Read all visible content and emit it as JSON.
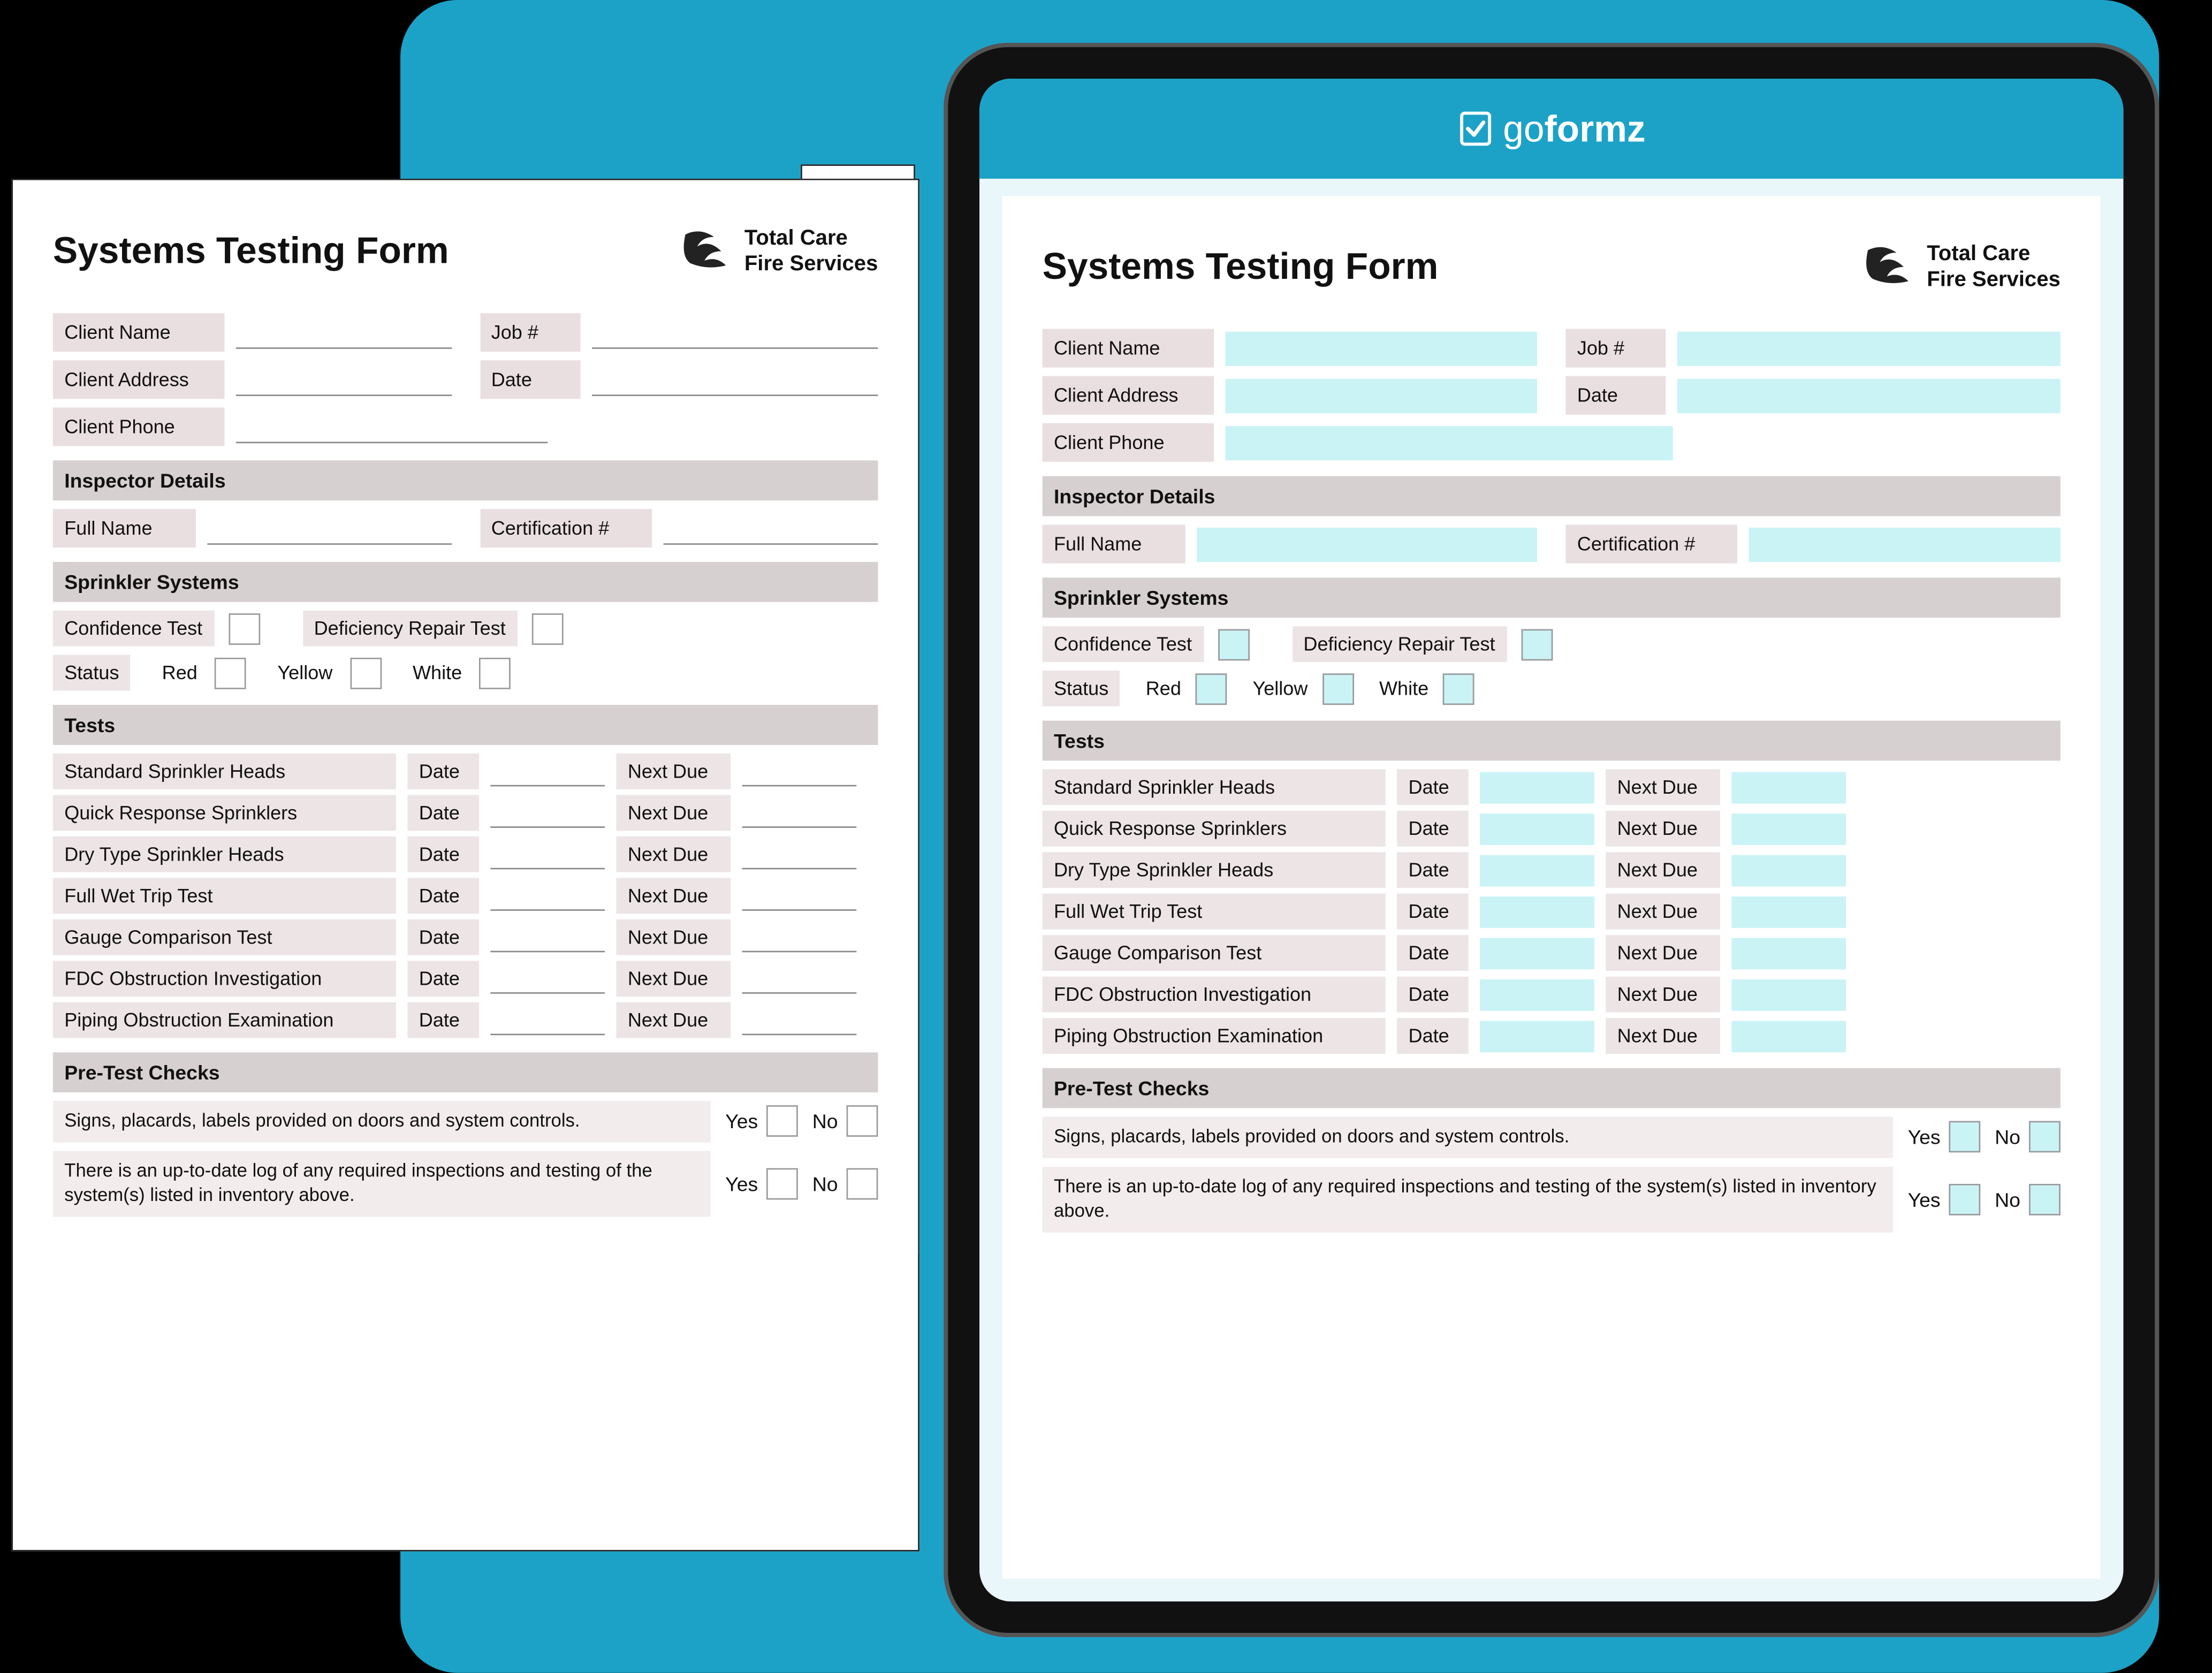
{
  "brand": {
    "go": "go",
    "formz": "formz"
  },
  "form": {
    "title": "Systems Testing Form",
    "company_line1": "Total Care",
    "company_line2": "Fire Services",
    "client_name_label": "Client Name",
    "client_address_label": "Client Address",
    "client_phone_label": "Client Phone",
    "job_label": "Job #",
    "date_label": "Date",
    "inspector_header": "Inspector Details",
    "full_name_label": "Full Name",
    "cert_label": "Certification #",
    "sprinkler_header": "Sprinkler Systems",
    "confidence_label": "Confidence Test",
    "deficiency_label": "Deficiency Repair Test",
    "status_label": "Status",
    "red_label": "Red",
    "yellow_label": "Yellow",
    "white_label": "White",
    "tests_header": "Tests",
    "date_col": "Date",
    "next_due_col": "Next Due",
    "tests": [
      "Standard Sprinkler Heads",
      "Quick Response Sprinklers",
      "Dry Type Sprinkler Heads",
      "Full Wet Trip Test",
      "Gauge Comparison Test",
      "FDC Obstruction Investigation",
      "Piping Obstruction Examination"
    ],
    "pretest_header": "Pre-Test Checks",
    "pretest1": "Signs, placards, labels provided on doors and system controls.",
    "pretest2": "There is an up-to-date log of any required inspections and testing of the system(s) listed in inventory above.",
    "yes_label": "Yes",
    "no_label": "No"
  }
}
